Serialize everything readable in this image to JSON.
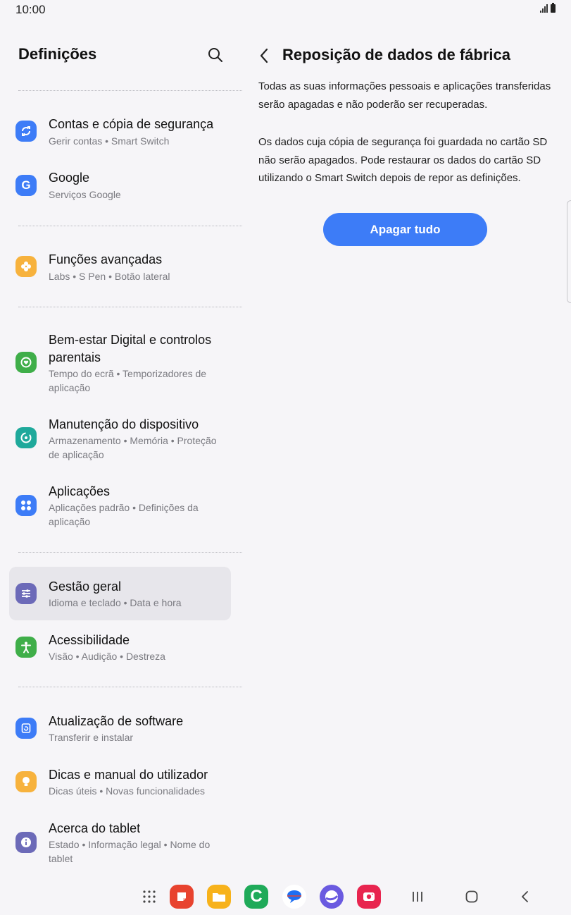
{
  "status": {
    "time": "10:00"
  },
  "left_panel": {
    "title": "Definições",
    "items": [
      {
        "title": "Contas e cópia de segurança",
        "subtitle": "Gerir contas • Smart Switch",
        "icon": "sync-icon",
        "color": "#3d7cf7"
      },
      {
        "title": "Google",
        "subtitle": "Serviços Google",
        "icon": "google-icon",
        "color": "#3d7cf7"
      },
      {
        "title": "Funções avançadas",
        "subtitle": "Labs • S Pen • Botão lateral",
        "icon": "puzzle-icon",
        "color": "#f7b23d"
      },
      {
        "title": "Bem-estar Digital e controlos parentais",
        "subtitle": "Tempo do ecrã • Temporizadores de aplicação",
        "icon": "wellbeing-icon",
        "color": "#3fae49"
      },
      {
        "title": "Manutenção do dispositivo",
        "subtitle": "Armazenamento • Memória • Proteção de aplicação",
        "icon": "device-care-icon",
        "color": "#1fa99b"
      },
      {
        "title": "Aplicações",
        "subtitle": "Aplicações padrão • Definições da aplicação",
        "icon": "apps-icon",
        "color": "#3d7cf7"
      },
      {
        "title": "Gestão geral",
        "subtitle": "Idioma e teclado • Data e hora",
        "icon": "sliders-icon",
        "color": "#6c6ab8",
        "selected": true
      },
      {
        "title": "Acessibilidade",
        "subtitle": "Visão • Audição • Destreza",
        "icon": "accessibility-icon",
        "color": "#3fae49"
      },
      {
        "title": "Atualização de software",
        "subtitle": "Transferir e instalar",
        "icon": "update-icon",
        "color": "#3d7cf7"
      },
      {
        "title": "Dicas e manual do utilizador",
        "subtitle": "Dicas úteis • Novas funcionalidades",
        "icon": "lightbulb-icon",
        "color": "#f7b23d"
      },
      {
        "title": "Acerca do tablet",
        "subtitle": "Estado • Informação legal • Nome do tablet",
        "icon": "info-icon",
        "color": "#6c6ab8"
      }
    ]
  },
  "right_panel": {
    "title": "Reposição de dados de fábrica",
    "paragraph1": "Todas as suas informações pessoais e aplicações transferidas serão apagadas e não poderão ser recuperadas.",
    "paragraph2": "Os dados cuja cópia de segurança foi guardada no cartão SD não serão apagados. Pode restaurar os dados do cartão SD utilizando o Smart Switch depois de repor as definições.",
    "button_label": "Apagar tudo"
  },
  "colors": {
    "accent": "#3d7cf7",
    "background": "#f6f5f8",
    "selected": "#e7e6eb"
  },
  "navbar": {
    "apps": [
      "apps-grid-icon",
      "notes-app-icon",
      "files-app-icon",
      "phone-app-icon",
      "messages-app-icon",
      "internet-app-icon",
      "camera-app-icon"
    ],
    "buttons": [
      "recents-icon",
      "home-icon",
      "back-icon"
    ]
  }
}
